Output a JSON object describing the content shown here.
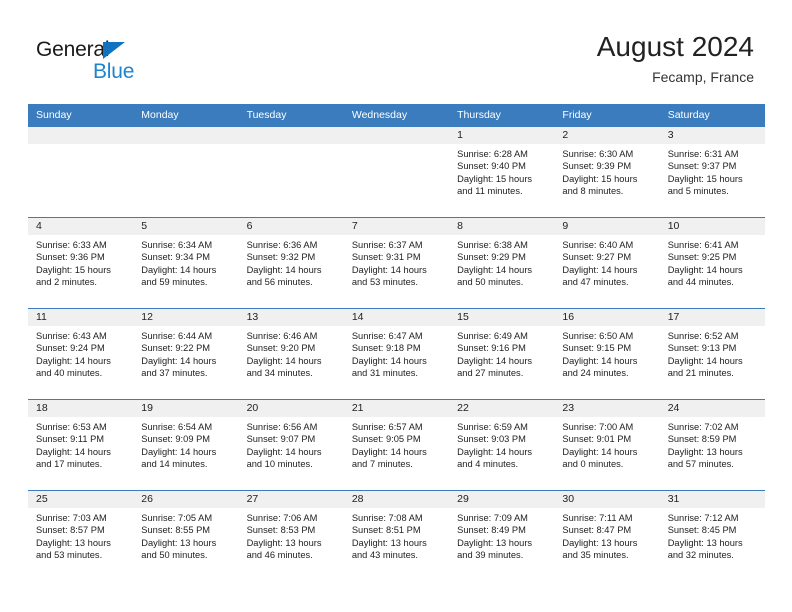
{
  "brand": {
    "name_part1": "General",
    "name_part2": "Blue",
    "triangle_color": "#1173bf",
    "blue_color": "#1d85d0"
  },
  "header": {
    "title": "August 2024",
    "subtitle": "Fecamp, France"
  },
  "theme": {
    "header_blue": "#3b7cbe",
    "date_band_gray": "#f0f0f0",
    "text_color": "#222222"
  },
  "weekdays": [
    "Sunday",
    "Monday",
    "Tuesday",
    "Wednesday",
    "Thursday",
    "Friday",
    "Saturday"
  ],
  "weeks": [
    {
      "days": [
        {
          "num": "",
          "sunrise": "",
          "sunset": "",
          "daylight1": "",
          "daylight2": ""
        },
        {
          "num": "",
          "sunrise": "",
          "sunset": "",
          "daylight1": "",
          "daylight2": ""
        },
        {
          "num": "",
          "sunrise": "",
          "sunset": "",
          "daylight1": "",
          "daylight2": ""
        },
        {
          "num": "",
          "sunrise": "",
          "sunset": "",
          "daylight1": "",
          "daylight2": ""
        },
        {
          "num": "1",
          "sunrise": "Sunrise: 6:28 AM",
          "sunset": "Sunset: 9:40 PM",
          "daylight1": "Daylight: 15 hours",
          "daylight2": "and 11 minutes."
        },
        {
          "num": "2",
          "sunrise": "Sunrise: 6:30 AM",
          "sunset": "Sunset: 9:39 PM",
          "daylight1": "Daylight: 15 hours",
          "daylight2": "and 8 minutes."
        },
        {
          "num": "3",
          "sunrise": "Sunrise: 6:31 AM",
          "sunset": "Sunset: 9:37 PM",
          "daylight1": "Daylight: 15 hours",
          "daylight2": "and 5 minutes."
        }
      ]
    },
    {
      "days": [
        {
          "num": "4",
          "sunrise": "Sunrise: 6:33 AM",
          "sunset": "Sunset: 9:36 PM",
          "daylight1": "Daylight: 15 hours",
          "daylight2": "and 2 minutes."
        },
        {
          "num": "5",
          "sunrise": "Sunrise: 6:34 AM",
          "sunset": "Sunset: 9:34 PM",
          "daylight1": "Daylight: 14 hours",
          "daylight2": "and 59 minutes."
        },
        {
          "num": "6",
          "sunrise": "Sunrise: 6:36 AM",
          "sunset": "Sunset: 9:32 PM",
          "daylight1": "Daylight: 14 hours",
          "daylight2": "and 56 minutes."
        },
        {
          "num": "7",
          "sunrise": "Sunrise: 6:37 AM",
          "sunset": "Sunset: 9:31 PM",
          "daylight1": "Daylight: 14 hours",
          "daylight2": "and 53 minutes."
        },
        {
          "num": "8",
          "sunrise": "Sunrise: 6:38 AM",
          "sunset": "Sunset: 9:29 PM",
          "daylight1": "Daylight: 14 hours",
          "daylight2": "and 50 minutes."
        },
        {
          "num": "9",
          "sunrise": "Sunrise: 6:40 AM",
          "sunset": "Sunset: 9:27 PM",
          "daylight1": "Daylight: 14 hours",
          "daylight2": "and 47 minutes."
        },
        {
          "num": "10",
          "sunrise": "Sunrise: 6:41 AM",
          "sunset": "Sunset: 9:25 PM",
          "daylight1": "Daylight: 14 hours",
          "daylight2": "and 44 minutes."
        }
      ]
    },
    {
      "days": [
        {
          "num": "11",
          "sunrise": "Sunrise: 6:43 AM",
          "sunset": "Sunset: 9:24 PM",
          "daylight1": "Daylight: 14 hours",
          "daylight2": "and 40 minutes."
        },
        {
          "num": "12",
          "sunrise": "Sunrise: 6:44 AM",
          "sunset": "Sunset: 9:22 PM",
          "daylight1": "Daylight: 14 hours",
          "daylight2": "and 37 minutes."
        },
        {
          "num": "13",
          "sunrise": "Sunrise: 6:46 AM",
          "sunset": "Sunset: 9:20 PM",
          "daylight1": "Daylight: 14 hours",
          "daylight2": "and 34 minutes."
        },
        {
          "num": "14",
          "sunrise": "Sunrise: 6:47 AM",
          "sunset": "Sunset: 9:18 PM",
          "daylight1": "Daylight: 14 hours",
          "daylight2": "and 31 minutes."
        },
        {
          "num": "15",
          "sunrise": "Sunrise: 6:49 AM",
          "sunset": "Sunset: 9:16 PM",
          "daylight1": "Daylight: 14 hours",
          "daylight2": "and 27 minutes."
        },
        {
          "num": "16",
          "sunrise": "Sunrise: 6:50 AM",
          "sunset": "Sunset: 9:15 PM",
          "daylight1": "Daylight: 14 hours",
          "daylight2": "and 24 minutes."
        },
        {
          "num": "17",
          "sunrise": "Sunrise: 6:52 AM",
          "sunset": "Sunset: 9:13 PM",
          "daylight1": "Daylight: 14 hours",
          "daylight2": "and 21 minutes."
        }
      ]
    },
    {
      "days": [
        {
          "num": "18",
          "sunrise": "Sunrise: 6:53 AM",
          "sunset": "Sunset: 9:11 PM",
          "daylight1": "Daylight: 14 hours",
          "daylight2": "and 17 minutes."
        },
        {
          "num": "19",
          "sunrise": "Sunrise: 6:54 AM",
          "sunset": "Sunset: 9:09 PM",
          "daylight1": "Daylight: 14 hours",
          "daylight2": "and 14 minutes."
        },
        {
          "num": "20",
          "sunrise": "Sunrise: 6:56 AM",
          "sunset": "Sunset: 9:07 PM",
          "daylight1": "Daylight: 14 hours",
          "daylight2": "and 10 minutes."
        },
        {
          "num": "21",
          "sunrise": "Sunrise: 6:57 AM",
          "sunset": "Sunset: 9:05 PM",
          "daylight1": "Daylight: 14 hours",
          "daylight2": "and 7 minutes."
        },
        {
          "num": "22",
          "sunrise": "Sunrise: 6:59 AM",
          "sunset": "Sunset: 9:03 PM",
          "daylight1": "Daylight: 14 hours",
          "daylight2": "and 4 minutes."
        },
        {
          "num": "23",
          "sunrise": "Sunrise: 7:00 AM",
          "sunset": "Sunset: 9:01 PM",
          "daylight1": "Daylight: 14 hours",
          "daylight2": "and 0 minutes."
        },
        {
          "num": "24",
          "sunrise": "Sunrise: 7:02 AM",
          "sunset": "Sunset: 8:59 PM",
          "daylight1": "Daylight: 13 hours",
          "daylight2": "and 57 minutes."
        }
      ]
    },
    {
      "days": [
        {
          "num": "25",
          "sunrise": "Sunrise: 7:03 AM",
          "sunset": "Sunset: 8:57 PM",
          "daylight1": "Daylight: 13 hours",
          "daylight2": "and 53 minutes."
        },
        {
          "num": "26",
          "sunrise": "Sunrise: 7:05 AM",
          "sunset": "Sunset: 8:55 PM",
          "daylight1": "Daylight: 13 hours",
          "daylight2": "and 50 minutes."
        },
        {
          "num": "27",
          "sunrise": "Sunrise: 7:06 AM",
          "sunset": "Sunset: 8:53 PM",
          "daylight1": "Daylight: 13 hours",
          "daylight2": "and 46 minutes."
        },
        {
          "num": "28",
          "sunrise": "Sunrise: 7:08 AM",
          "sunset": "Sunset: 8:51 PM",
          "daylight1": "Daylight: 13 hours",
          "daylight2": "and 43 minutes."
        },
        {
          "num": "29",
          "sunrise": "Sunrise: 7:09 AM",
          "sunset": "Sunset: 8:49 PM",
          "daylight1": "Daylight: 13 hours",
          "daylight2": "and 39 minutes."
        },
        {
          "num": "30",
          "sunrise": "Sunrise: 7:11 AM",
          "sunset": "Sunset: 8:47 PM",
          "daylight1": "Daylight: 13 hours",
          "daylight2": "and 35 minutes."
        },
        {
          "num": "31",
          "sunrise": "Sunrise: 7:12 AM",
          "sunset": "Sunset: 8:45 PM",
          "daylight1": "Daylight: 13 hours",
          "daylight2": "and 32 minutes."
        }
      ]
    }
  ]
}
